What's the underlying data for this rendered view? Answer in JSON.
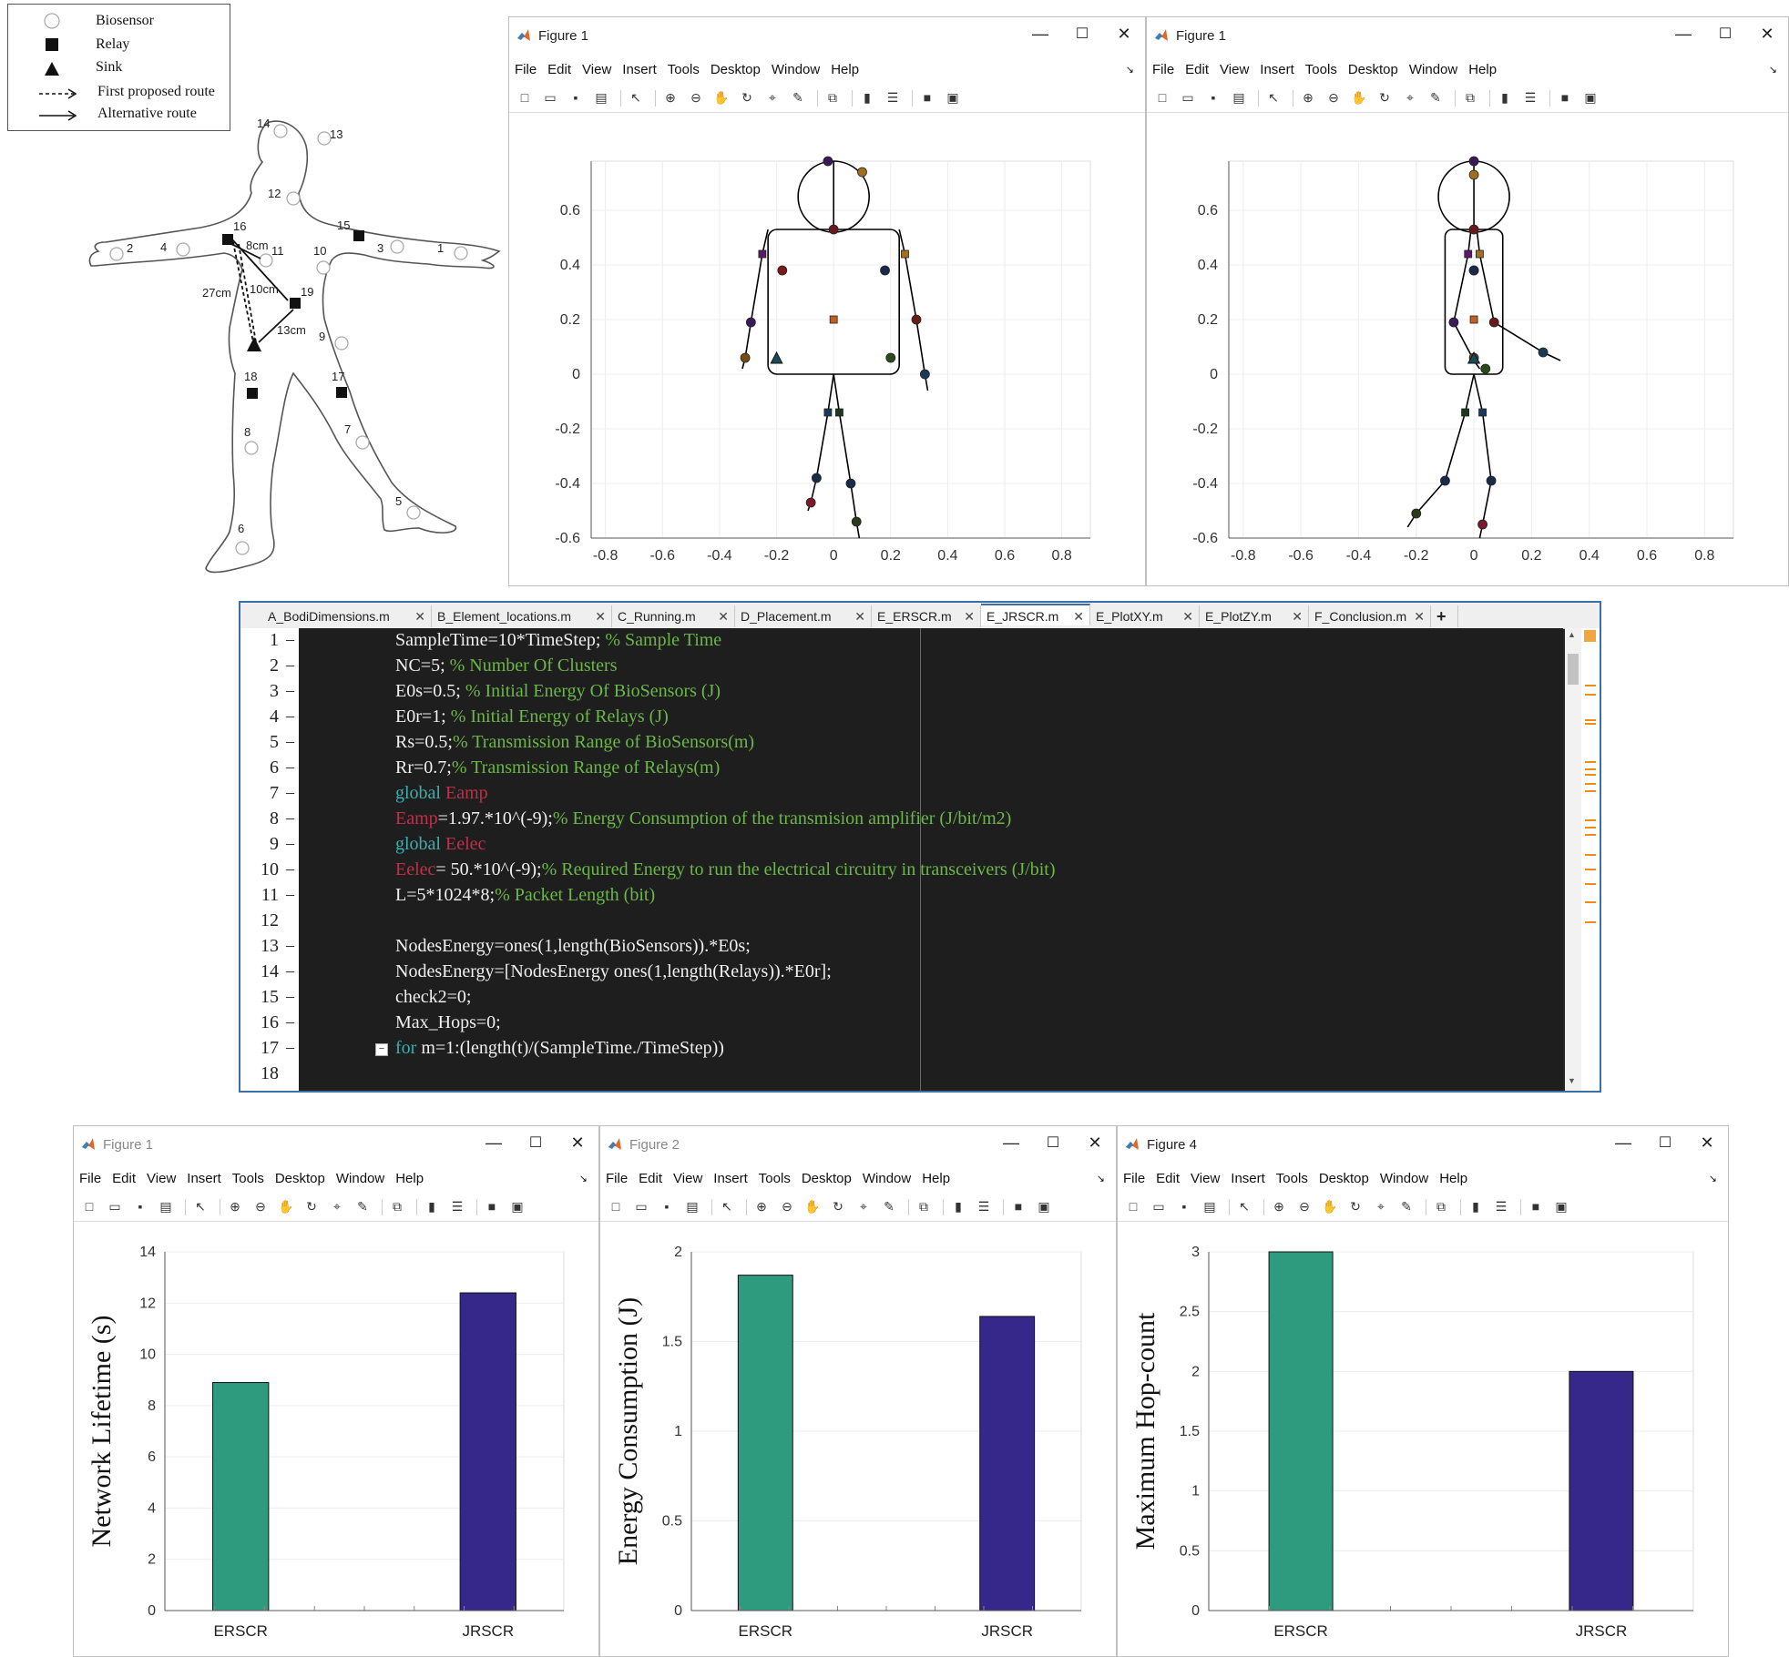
{
  "diagram": {
    "legend": [
      "Biosensor",
      "Relay",
      "Sink",
      "First proposed route",
      "Alternative route"
    ],
    "biosensor_labels": [
      "1",
      "2",
      "3",
      "4",
      "5",
      "6",
      "7",
      "8",
      "9",
      "10",
      "11",
      "12",
      "13",
      "14"
    ],
    "relay_labels": [
      "15",
      "16",
      "17",
      "18",
      "19"
    ],
    "distances": [
      "8cm",
      "27cm",
      "10cm",
      "13cm"
    ]
  },
  "figures_top": [
    {
      "title": "Figure 1",
      "menu": [
        "File",
        "Edit",
        "View",
        "Insert",
        "Tools",
        "Desktop",
        "Window",
        "Help"
      ],
      "y_ticks": [
        "0.6",
        "0.4",
        "0.2",
        "0",
        "-0.2",
        "-0.4",
        "-0.6"
      ],
      "x_ticks": [
        "-0.8",
        "-0.6",
        "-0.4",
        "-0.2",
        "0",
        "0.2",
        "0.4",
        "0.6",
        "0.8"
      ]
    },
    {
      "title": "Figure 1",
      "menu": [
        "File",
        "Edit",
        "View",
        "Insert",
        "Tools",
        "Desktop",
        "Window",
        "Help"
      ],
      "y_ticks": [
        "0.6",
        "0.4",
        "0.2",
        "0",
        "-0.2",
        "-0.4",
        "-0.6"
      ],
      "x_ticks": [
        "-0.8",
        "-0.6",
        "-0.4",
        "-0.2",
        "0",
        "0.2",
        "0.4",
        "0.6",
        "0.8"
      ]
    }
  ],
  "editor": {
    "tabs": [
      "A_BodiDimensions.m",
      "B_Element_locations.m",
      "C_Running.m",
      "D_Placement.m",
      "E_ERSCR.m",
      "E_JRSCR.m",
      "E_PlotXY.m",
      "E_PlotZY.m",
      "F_Conclusion.m"
    ],
    "active_tab": "E_JRSCR.m",
    "add_tab": "+",
    "line_numbers": [
      "1",
      "2",
      "3",
      "4",
      "5",
      "6",
      "7",
      "8",
      "9",
      "10",
      "11",
      "12",
      "13",
      "14",
      "15",
      "16",
      "17",
      "18"
    ],
    "lines": [
      [
        {
          "t": "SampleTime=10*TimeStep; ",
          "c": "n"
        },
        {
          "t": "% Sample Time",
          "c": "cm"
        }
      ],
      [
        {
          "t": "NC=5; ",
          "c": "n"
        },
        {
          "t": "% Number Of Clusters",
          "c": "cm"
        }
      ],
      [
        {
          "t": "E0s=0.5; ",
          "c": "n"
        },
        {
          "t": "% Initial Energy Of BioSensors (J)",
          "c": "cm"
        }
      ],
      [
        {
          "t": "E0r=1; ",
          "c": "n"
        },
        {
          "t": "% Initial Energy of Relays (J)",
          "c": "cm"
        }
      ],
      [
        {
          "t": "Rs=0.5;",
          "c": "n"
        },
        {
          "t": "% Transmission Range of BioSensors(m)",
          "c": "cm"
        }
      ],
      [
        {
          "t": "Rr=0.7;",
          "c": "n"
        },
        {
          "t": "% Transmission Range of Relays(m)",
          "c": "cm"
        }
      ],
      [
        {
          "t": "global ",
          "c": "kw"
        },
        {
          "t": "Eamp",
          "c": "gv"
        }
      ],
      [
        {
          "t": "Eamp",
          "c": "gv"
        },
        {
          "t": "=1.97.*10^(-9);",
          "c": "n"
        },
        {
          "t": "% Energy Consumption of the transmision amplifier (J/bit/m2)",
          "c": "cm"
        }
      ],
      [
        {
          "t": "global ",
          "c": "kw"
        },
        {
          "t": "Eelec",
          "c": "gv"
        }
      ],
      [
        {
          "t": "Eelec",
          "c": "gv"
        },
        {
          "t": "= 50.*10^(-9);",
          "c": "n"
        },
        {
          "t": "% Required Energy to run the electrical circuitry in transceivers (J/bit)",
          "c": "cm"
        }
      ],
      [
        {
          "t": "L=5*1024*8;",
          "c": "n"
        },
        {
          "t": "% Packet Length (bit)",
          "c": "cm"
        }
      ],
      [],
      [
        {
          "t": "NodesEnergy=ones(1,length(BioSensors)).*E0s;",
          "c": "n"
        }
      ],
      [
        {
          "t": "NodesEnergy=[NodesEnergy ones(1,length(Relays)).*E0r];",
          "c": "n"
        }
      ],
      [
        {
          "t": "check2=0;",
          "c": "n"
        }
      ],
      [
        {
          "t": "Max_Hops=0;",
          "c": "n"
        }
      ],
      [
        {
          "t": "for ",
          "c": "kw"
        },
        {
          "t": "m=1:(length(t)/(SampleTime./TimeStep))",
          "c": "n"
        }
      ],
      []
    ]
  },
  "figures_bottom": [
    {
      "title": "Figure 1",
      "menu": [
        "File",
        "Edit",
        "View",
        "Insert",
        "Tools",
        "Desktop",
        "Window",
        "Help"
      ],
      "chart_data": {
        "type": "bar",
        "categories": [
          "ERSCR",
          "JRSCR"
        ],
        "values": [
          8.9,
          12.4
        ],
        "ylabel": "Network Lifetime (s)",
        "ylim": [
          0,
          14
        ],
        "yticks": [
          "0",
          "2",
          "4",
          "6",
          "8",
          "10",
          "12",
          "14"
        ],
        "colors": [
          "#2e9b7e",
          "#36288a"
        ]
      }
    },
    {
      "title": "Figure 2",
      "menu": [
        "File",
        "Edit",
        "View",
        "Insert",
        "Tools",
        "Desktop",
        "Window",
        "Help"
      ],
      "chart_data": {
        "type": "bar",
        "categories": [
          "ERSCR",
          "JRSCR"
        ],
        "values": [
          1.87,
          1.64
        ],
        "ylabel": "Energy Consumption (J)",
        "ylim": [
          0,
          2
        ],
        "yticks": [
          "0",
          "0.5",
          "1",
          "1.5",
          "2"
        ],
        "colors": [
          "#2e9b7e",
          "#36288a"
        ]
      }
    },
    {
      "title": "Figure 4",
      "menu": [
        "File",
        "Edit",
        "View",
        "Insert",
        "Tools",
        "Desktop",
        "Window",
        "Help"
      ],
      "chart_data": {
        "type": "bar",
        "categories": [
          "ERSCR",
          "JRSCR"
        ],
        "values": [
          3,
          2
        ],
        "ylabel": "Maximum Hop-count",
        "ylim": [
          0,
          3
        ],
        "yticks": [
          "0",
          "0.5",
          "1",
          "1.5",
          "2",
          "2.5",
          "3"
        ],
        "colors": [
          "#2e9b7e",
          "#36288a"
        ]
      }
    }
  ]
}
